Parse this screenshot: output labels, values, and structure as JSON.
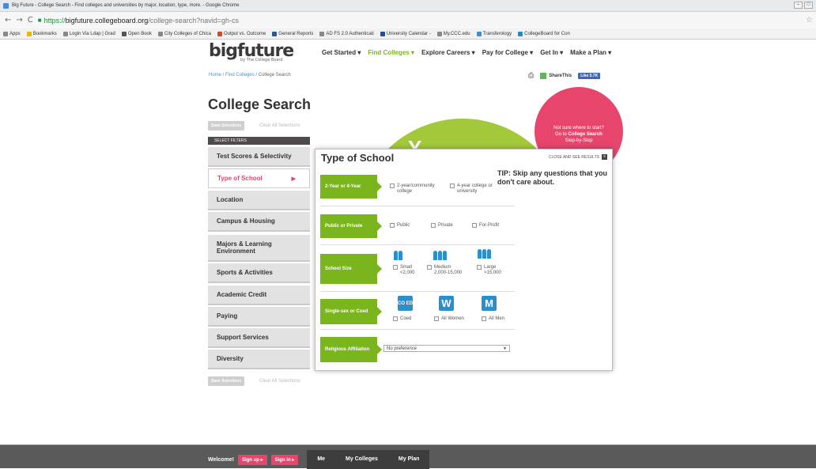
{
  "browser": {
    "title": "Big Future - College Search - Find colleges and universities by major, location, type, more. - Google Chrome",
    "url_https": "https://",
    "url_host": "bigfuture.collegeboard.org",
    "url_path": "/college-search?navid=gh-cs",
    "bookmarks": [
      "Apps",
      "Bookmarks",
      "Login Via Ldap | Grad",
      "Open Book",
      "City Colleges of Chica",
      "Output vs. Outcome",
      "General Reports",
      "AD FS 2.0 Authenticati",
      "University Calendar -",
      "My.CCC.edu",
      "Transferology",
      "CollegeBoard for Con"
    ]
  },
  "site": {
    "logo": "bigfuture",
    "logo_sub": "by The College Board",
    "nav": [
      "Get Started",
      "Find Colleges",
      "Explore Careers",
      "Pay for College",
      "Get In",
      "Make a Plan"
    ],
    "breadcrumb_home": "Home",
    "breadcrumb_find": "Find Colleges",
    "breadcrumb_current": "College Search",
    "share_label": "ShareThis",
    "like_label": "Like 5.7K"
  },
  "main": {
    "title": "College Search",
    "save_label": "Save Selections",
    "clear_label": "Clear All Selections",
    "filter_header": "SELECT FILTERS",
    "filters": [
      "Test Scores & Selectivity",
      "Type of School",
      "Location",
      "Campus & Housing",
      "Majors & Learning Environment",
      "Sports & Activities",
      "Academic Credit",
      "Paying",
      "Support Services",
      "Diversity"
    ],
    "tip_circle": [
      "Not sure where to start?",
      "Go to",
      "College Search",
      "Step-by-Step"
    ]
  },
  "panel": {
    "title": "Type of School",
    "close_label": "CLOSE AND SEE RESULTS",
    "tip": "TIP: Skip any questions that you don't care about.",
    "rows": {
      "year": {
        "label": "2-Year or 4-Year",
        "opt1": "2-year/community college",
        "opt2": "4-year college or university"
      },
      "public": {
        "label": "Public or Private",
        "opt1": "Public",
        "opt2": "Private",
        "opt3": "For-Profit"
      },
      "size": {
        "label": "School Size",
        "small": "Small",
        "small_range": "<2,000",
        "medium": "Medium",
        "medium_range": "2,000-15,000",
        "large": "Large",
        "large_range": ">15,000"
      },
      "coed": {
        "label": "Single-sex or Coed",
        "badge1": "CO ED",
        "badge2": "W",
        "badge3": "M",
        "opt1": "Coed",
        "opt2": "All Women",
        "opt3": "All Men"
      },
      "religious": {
        "label": "Religious Affiliation",
        "select_value": "No preference"
      }
    }
  },
  "footer": {
    "welcome": "Welcome!",
    "signup": "Sign up",
    "signin": "Sign in",
    "tabs": [
      "Me",
      "My Colleges",
      "My Plan"
    ]
  }
}
